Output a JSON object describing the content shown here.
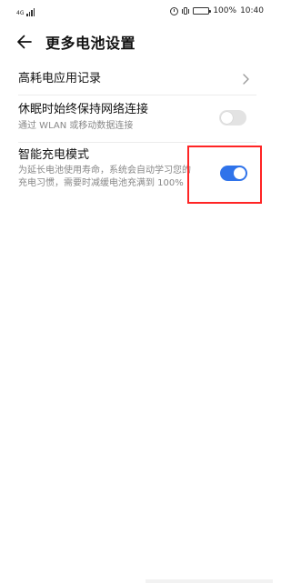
{
  "status_bar": {
    "signal_label": "4G",
    "battery_percent": "100%",
    "time": "10:40",
    "icons": [
      "signal-icon",
      "alarm-icon",
      "vibrate-icon",
      "battery-icon"
    ]
  },
  "header": {
    "title": "更多电池设置",
    "back_icon": "back-arrow-icon"
  },
  "settings": {
    "records": {
      "title": "高耗电应用记录",
      "icon": "chevron-right-icon"
    },
    "network": {
      "title": "休眠时始终保持网络连接",
      "subtitle": "通过 WLAN 或移动数据连接",
      "enabled": false
    },
    "smart_charge": {
      "title": "智能充电模式",
      "subtitle": "为延长电池使用寿命，系统会自动学习您的充电习惯，需要时减缓电池充满到 100%",
      "enabled": true
    }
  },
  "colors": {
    "accent": "#2f73ea",
    "highlight": "#ff2424",
    "toggle_off": "#e3e3e3",
    "subtitle": "#888888"
  }
}
